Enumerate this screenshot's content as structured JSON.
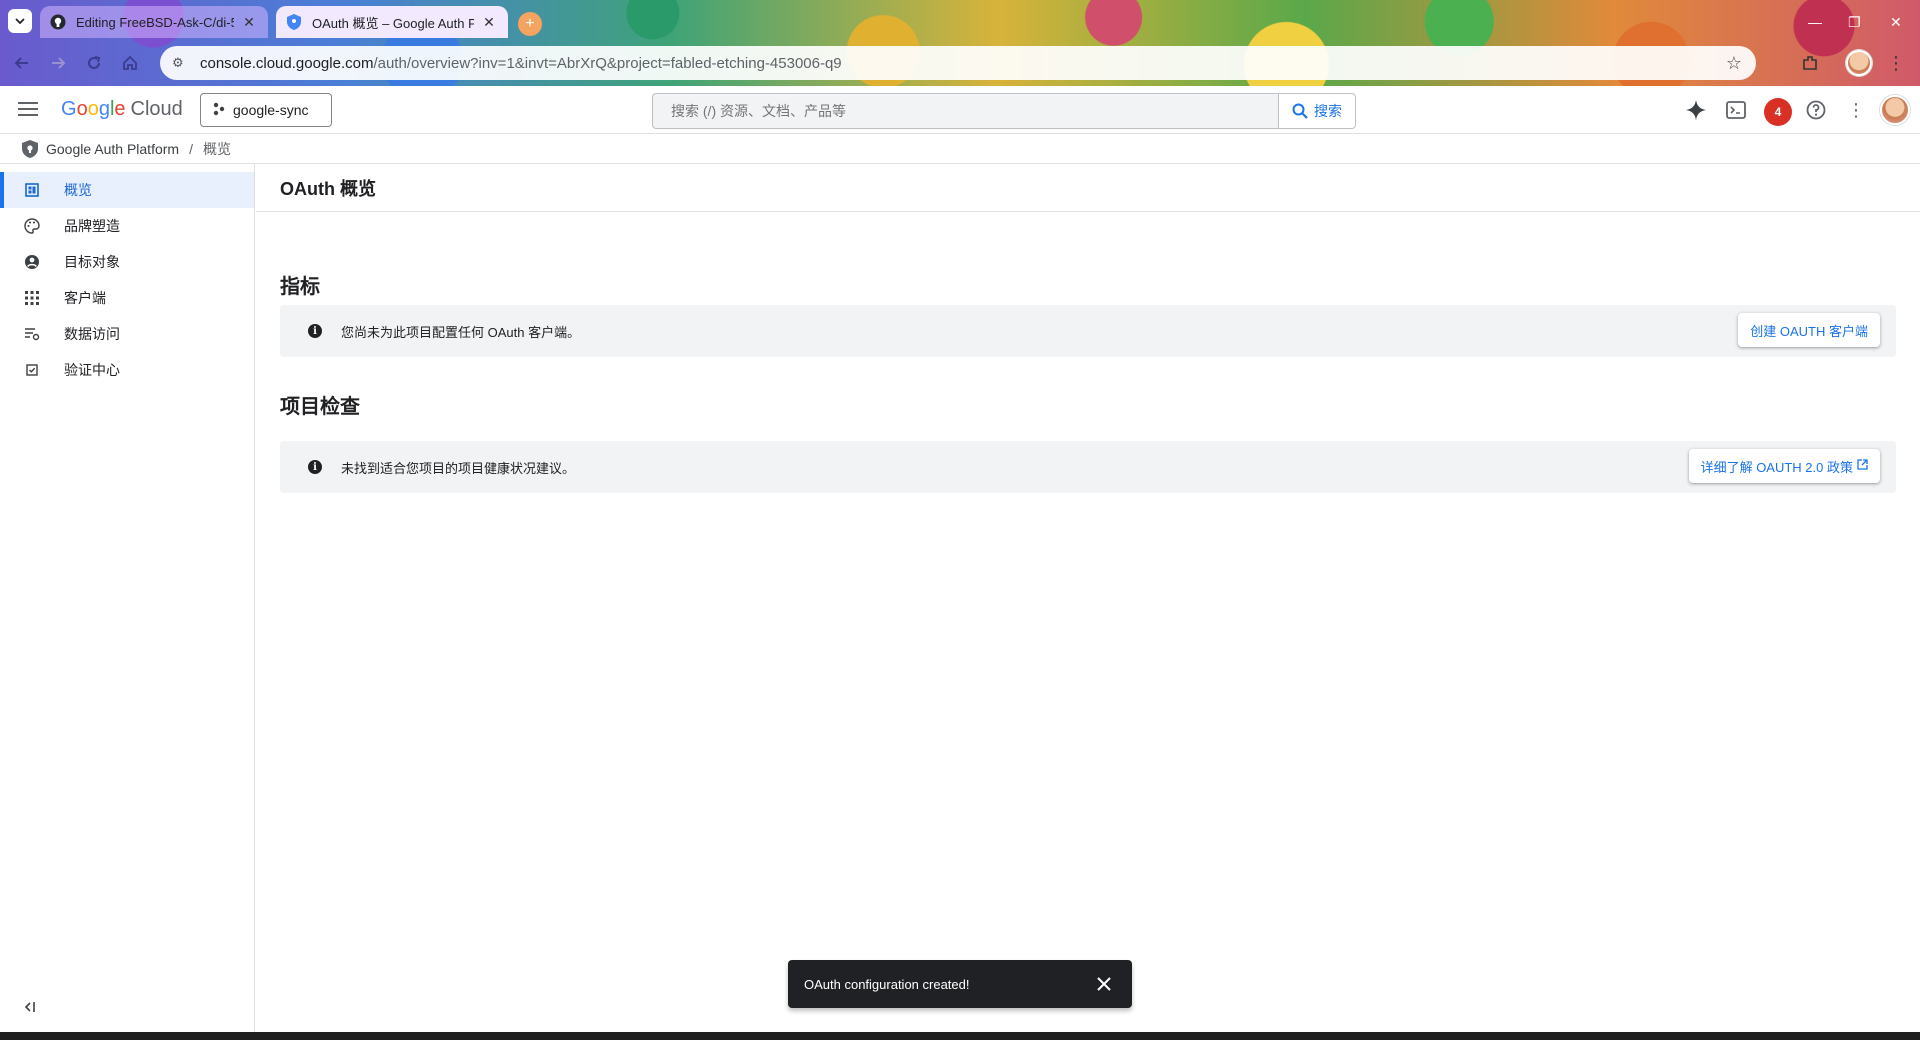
{
  "browser": {
    "tabs": [
      {
        "title": "Editing FreeBSD-Ask-C/di-5",
        "icon": "github-icon",
        "active": false
      },
      {
        "title": "OAuth 概览 – Google Auth Platform",
        "icon": "shield-icon",
        "active": true
      }
    ],
    "new_tab_label": "+",
    "url_host": "console.cloud.google.com",
    "url_path": "/auth/overview?inv=1&invt=AbrXrQ&project=fabled-etching-453006-q9"
  },
  "header": {
    "logo_google": [
      "G",
      "o",
      "o",
      "g",
      "l",
      "e"
    ],
    "logo_cloud": "Cloud",
    "project": "google-sync",
    "search_placeholder": "搜索 (/) 资源、文档、产品等",
    "search_button": "搜索",
    "notification_count": "4"
  },
  "breadcrumb": {
    "product": "Google Auth Platform",
    "separator": "/",
    "current": "概览"
  },
  "sidebar": {
    "items": [
      {
        "label": "概览",
        "icon": "dashboard-icon",
        "active": true
      },
      {
        "label": "品牌塑造",
        "icon": "palette-icon",
        "active": false
      },
      {
        "label": "目标对象",
        "icon": "account-icon",
        "active": false
      },
      {
        "label": "客户端",
        "icon": "apps-grid-icon",
        "active": false
      },
      {
        "label": "数据访问",
        "icon": "data-access-icon",
        "active": false
      },
      {
        "label": "验证中心",
        "icon": "verified-icon",
        "active": false
      }
    ],
    "collapse_label": "<|"
  },
  "main": {
    "title": "OAuth 概览",
    "metrics": {
      "heading": "指标",
      "message": "您尚未为此项目配置任何 OAuth 客户端。",
      "button": "创建 OAUTH 客户端"
    },
    "checkup": {
      "heading": "项目检查",
      "message": "未找到适合您项目的项目健康状况建议。",
      "button": "详细了解 OAUTH 2.0 政策"
    }
  },
  "snackbar": {
    "message": "OAuth configuration created!"
  },
  "colors": {
    "accent": "#1a73e8",
    "sidebar_active_bg": "#e8f0fe",
    "notification": "#d93025",
    "snackbar_bg": "#202124"
  }
}
